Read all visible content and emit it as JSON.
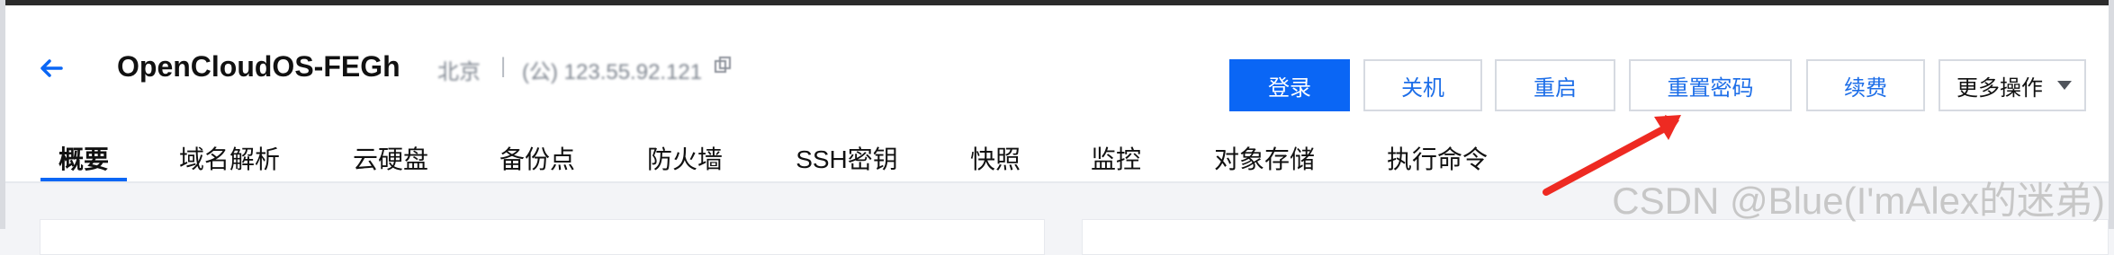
{
  "header": {
    "title": "OpenCloudOS-FEGh",
    "region_text": "北京",
    "separator": "|",
    "ip_text": "(公) 123.55.92.121",
    "back_icon": "arrow-left-icon",
    "copy_icon": "copy-icon"
  },
  "actions": {
    "login": "登录",
    "shutdown": "关机",
    "restart": "重启",
    "reset_password": "重置密码",
    "renew": "续费",
    "more": "更多操作"
  },
  "tabs": [
    {
      "label": "概要",
      "active": true
    },
    {
      "label": "域名解析"
    },
    {
      "label": "云硬盘"
    },
    {
      "label": "备份点"
    },
    {
      "label": "防火墙"
    },
    {
      "label": "SSH密钥"
    },
    {
      "label": "快照"
    },
    {
      "label": "监控"
    },
    {
      "label": "对象存储"
    },
    {
      "label": "执行命令"
    }
  ],
  "annotation": {
    "arrow_color": "#ee2a22"
  },
  "watermark": "CSDN @Blue(I'mAlex的迷弟)",
  "colors": {
    "primary": "#0a66f5",
    "link": "#1d6ee8",
    "border": "#d6dae1"
  }
}
